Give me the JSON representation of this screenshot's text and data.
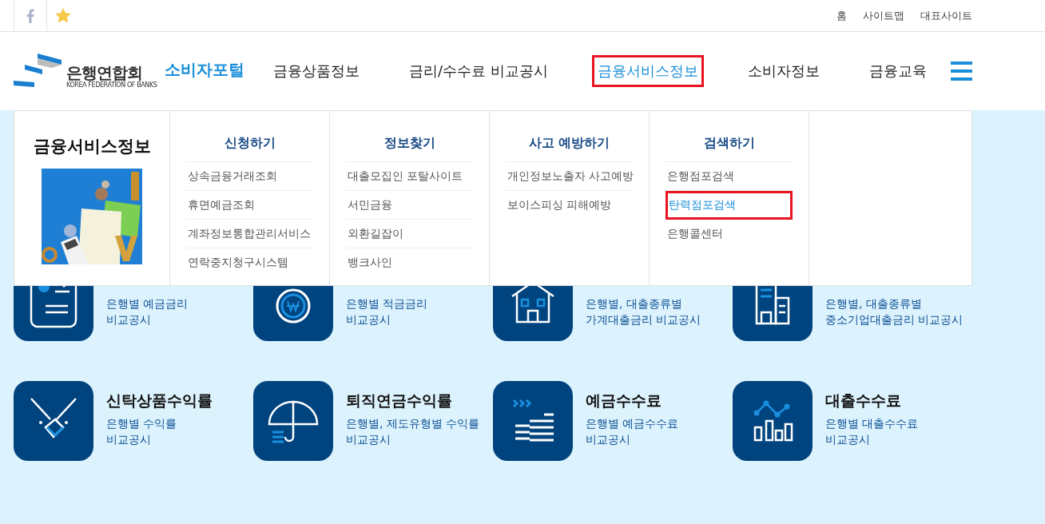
{
  "top_bar": {
    "links": [
      "홈",
      "사이트맵",
      "대표사이트"
    ]
  },
  "logo": {
    "name": "은행연합회",
    "subtitle": "KOREA FEDERATION OF BANKS",
    "portal": "소비자포털"
  },
  "nav": [
    {
      "label": "금융상품정보",
      "selected": false
    },
    {
      "label": "금리/수수료 비교공시",
      "selected": false
    },
    {
      "label": "금융서비스정보",
      "selected": true
    },
    {
      "label": "소비자정보",
      "selected": false
    },
    {
      "label": "금융교육",
      "selected": false
    }
  ],
  "mega_menu": {
    "title": "금융서비스정보",
    "columns": [
      {
        "heading": "신청하기",
        "items": [
          {
            "label": "상속금융거래조회",
            "selected": false
          },
          {
            "label": "휴면예금조회",
            "selected": false
          },
          {
            "label": "계좌정보통합관리서비스",
            "selected": false
          },
          {
            "label": "연락중지청구시스템",
            "selected": false
          }
        ]
      },
      {
        "heading": "정보찾기",
        "items": [
          {
            "label": "대출모집인 포탈사이트",
            "selected": false
          },
          {
            "label": "서민금융",
            "selected": false
          },
          {
            "label": "외환길잡이",
            "selected": false
          },
          {
            "label": "뱅크사인",
            "selected": false
          }
        ]
      },
      {
        "heading": "사고 예방하기",
        "items": [
          {
            "label": "개인정보노출자 사고예방",
            "selected": false
          },
          {
            "label": "보이스피싱 피해예방",
            "selected": false
          }
        ]
      },
      {
        "heading": "검색하기",
        "items": [
          {
            "label": "은행점포검색",
            "selected": false
          },
          {
            "label": "탄력점포검색",
            "selected": true
          },
          {
            "label": "은행콜센터",
            "selected": false
          }
        ]
      }
    ]
  },
  "tiles": [
    {
      "lines": [
        "은행별 예금금리",
        "비교공시"
      ]
    },
    {
      "lines": [
        "은행별 적금금리",
        "비교공시"
      ]
    },
    {
      "lines": [
        "은행별, 대출종류별",
        "가계대출금리 비교공시"
      ]
    },
    {
      "lines": [
        "은행별, 대출종류별",
        "중소기업대출금리 비교공시"
      ]
    },
    {
      "title": "신탁상품수익률",
      "lines": [
        "은행별 수익률",
        "비교공시"
      ]
    },
    {
      "title": "퇴직연금수익률",
      "lines": [
        "은행별, 제도유형별 수익률",
        "비교공시"
      ]
    },
    {
      "title": "예금수수료",
      "lines": [
        "은행별 예금수수료",
        "비교공시"
      ]
    },
    {
      "title": "대출수수료",
      "lines": [
        "은행별 대출수수료",
        "비교공시"
      ]
    }
  ]
}
